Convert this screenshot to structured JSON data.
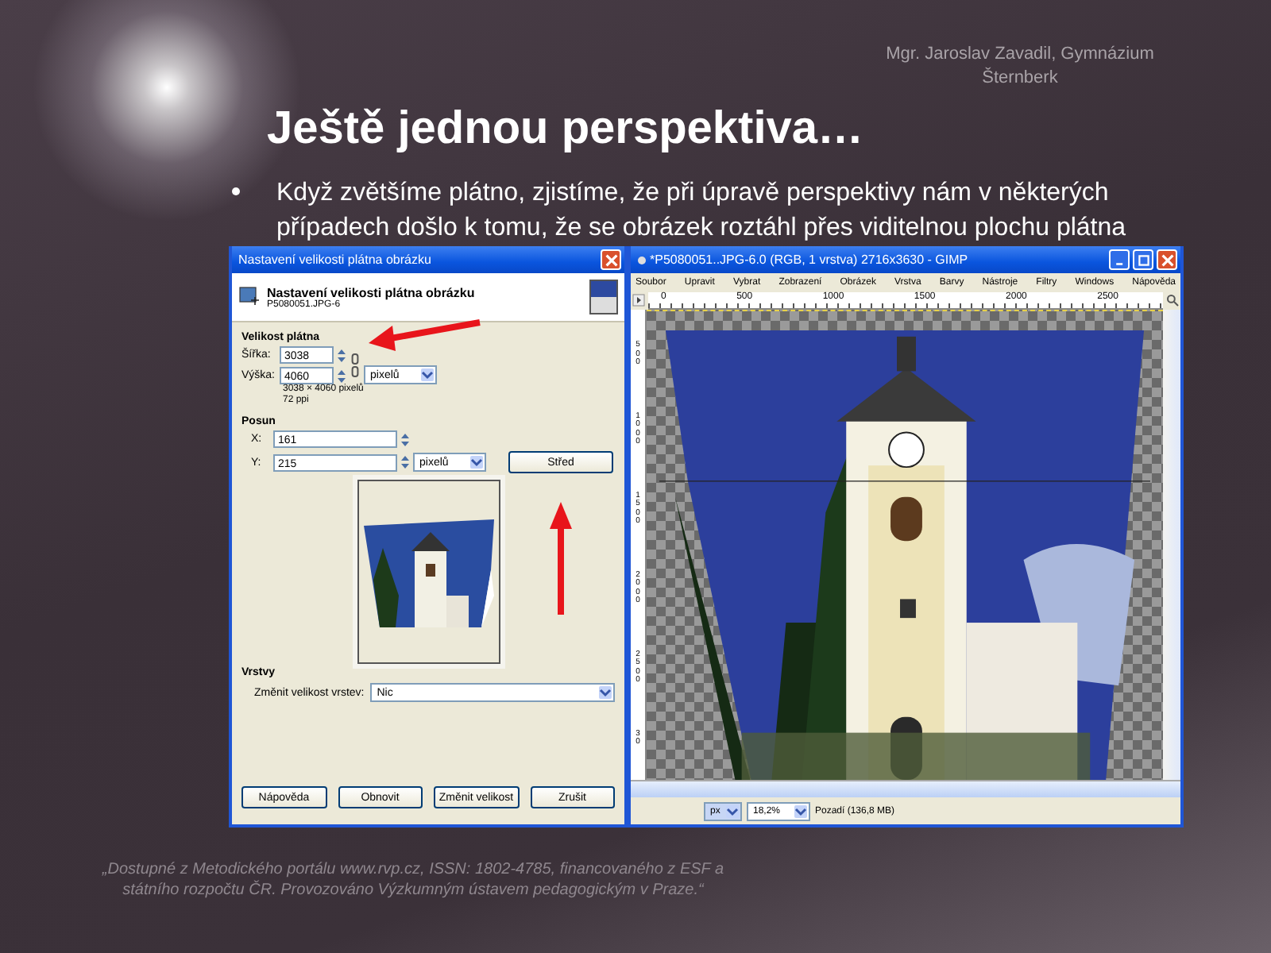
{
  "author": "Mgr. Jaroslav Zavadil, Gymnázium Šternberk",
  "title": "Ještě jednou perspektiva…",
  "bullets": [
    "Když zvětšíme plátno, zjistíme, že při úpravě perspektivy nám v některých případech došlo k tomu, že se obrázek roztáhl přes viditelnou plochu plátna"
  ],
  "canvas_dialog": {
    "title": "Nastavení velikosti plátna obrázku",
    "heading": "Nastavení velikosti plátna obrázku",
    "subheading": "P5080051.JPG-6",
    "size_section": "Velikost plátna",
    "size_fields": [
      {
        "label": "Šířka:",
        "value": "3038"
      },
      {
        "label": "Výška:",
        "value": "4060"
      }
    ],
    "size_unit": "pixelů",
    "size_info": "3038 × 4060 pixelů",
    "resolution": "72 ppi",
    "offset_section": "Posun",
    "offset_fields": [
      {
        "label": "X:",
        "value": "161"
      },
      {
        "label": "Y:",
        "value": "215"
      }
    ],
    "offset_unit": "pixelů",
    "center_button": "Střed",
    "layers_section": "Vrstvy",
    "resize_layers_label": "Změnit velikost vrstev:",
    "resize_layers_value": "Nic",
    "buttons": [
      "Nápověda",
      "Obnovit",
      "Změnit velikost",
      "Zrušit"
    ]
  },
  "gimp_window": {
    "title": "*P5080051..JPG-6.0 (RGB, 1 vrstva) 2716x3630 - GIMP",
    "menu": [
      "Soubor",
      "Upravit",
      "Vybrat",
      "Zobrazení",
      "Obrázek",
      "Vrstva",
      "Barvy",
      "Nástroje",
      "Filtry",
      "Windows",
      "Nápověda"
    ],
    "ruler_ticks": [
      "0",
      "500",
      "1000",
      "1500",
      "2000",
      "2500"
    ],
    "vertical_ruler_ticks": [
      "500",
      "1000",
      "1500",
      "2000",
      "2500",
      "30"
    ],
    "unit": "px",
    "zoom": "18,2%",
    "status": "Pozadí (136,8 MB)"
  },
  "footer": "„Dostupné z Metodického portálu www.rvp.cz, ISSN: 1802-4785, financovaného z ESF a státního rozpočtu ČR. Provozováno Výzkumným ústavem pedagogickým v Praze.“"
}
